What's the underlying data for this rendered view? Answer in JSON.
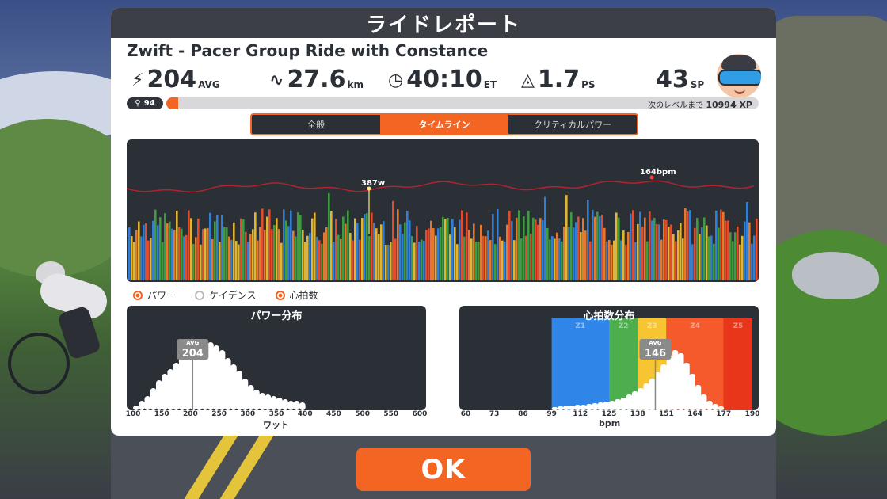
{
  "title": "ライドレポート",
  "ride_name": "Zwift - Pacer Group Ride with Constance",
  "stats": {
    "power": {
      "value": "204",
      "unit": "AVG"
    },
    "distance": {
      "value": "27.6",
      "unit": "km"
    },
    "time": {
      "value": "40:10",
      "unit": "ET"
    },
    "pizza": {
      "value": "1.7",
      "unit": "PS"
    },
    "sport": {
      "value": "43",
      "unit": "SP"
    }
  },
  "level": {
    "value": "94",
    "xp_label": "次のレベルまで",
    "xp_value": "10994 XP",
    "progress": 0.02
  },
  "tabs": [
    {
      "label": "全般",
      "active": false
    },
    {
      "label": "タイムライン",
      "active": true
    },
    {
      "label": "クリティカルパワー",
      "active": false
    }
  ],
  "timeline": {
    "peak_power_label": "387w",
    "peak_hr_label": "164bpm"
  },
  "legend": [
    {
      "label": "パワー",
      "on": true
    },
    {
      "label": "ケイデンス",
      "on": false
    },
    {
      "label": "心拍数",
      "on": true
    }
  ],
  "power_hist": {
    "title": "パワー分布",
    "avg_tag": "AVG",
    "avg_value": "204",
    "avg_watts": 204,
    "ticks": [
      "100",
      "150",
      "200",
      "250",
      "300",
      "350",
      "400",
      "450",
      "500",
      "550",
      "600"
    ],
    "xlabel": "ワット",
    "bins": [
      100,
      110,
      120,
      130,
      140,
      150,
      160,
      170,
      180,
      190,
      200,
      210,
      220,
      230,
      240,
      250,
      260,
      270,
      280,
      290,
      300,
      310,
      320,
      330,
      340,
      350,
      360,
      370,
      380,
      390
    ],
    "heights": [
      6,
      12,
      18,
      28,
      38,
      46,
      52,
      60,
      72,
      82,
      90,
      90,
      88,
      86,
      82,
      76,
      66,
      58,
      50,
      40,
      32,
      26,
      22,
      20,
      18,
      16,
      14,
      12,
      12,
      10
    ]
  },
  "hr_hist": {
    "title": "心拍数分布",
    "avg_tag": "AVG",
    "avg_value": "146",
    "avg_bpm": 146,
    "ticks": [
      "60",
      "73",
      "86",
      "99",
      "112",
      "125",
      "138",
      "151",
      "164",
      "177",
      "190"
    ],
    "xlabel": "bpm",
    "zones": [
      {
        "label": "Z1",
        "from": 99,
        "to": 125,
        "color": "#2f86e8"
      },
      {
        "label": "Z2",
        "from": 125,
        "to": 138,
        "color": "#4cae4c"
      },
      {
        "label": "Z3",
        "from": 138,
        "to": 151,
        "color": "#f7c531"
      },
      {
        "label": "Z4",
        "from": 151,
        "to": 177,
        "color": "#f55a2c"
      },
      {
        "label": "Z5",
        "from": 177,
        "to": 190,
        "color": "#e8361a"
      }
    ],
    "heights": [
      4,
      5,
      6,
      6,
      7,
      7,
      8,
      9,
      10,
      11,
      12,
      14,
      16,
      20,
      24,
      28,
      34,
      40,
      48,
      58,
      70,
      76,
      72,
      60,
      46,
      32,
      20,
      12,
      8,
      5
    ]
  },
  "ok_label": "OK",
  "colors": {
    "accent": "#f26522",
    "panel_dark": "#2b2f36"
  }
}
